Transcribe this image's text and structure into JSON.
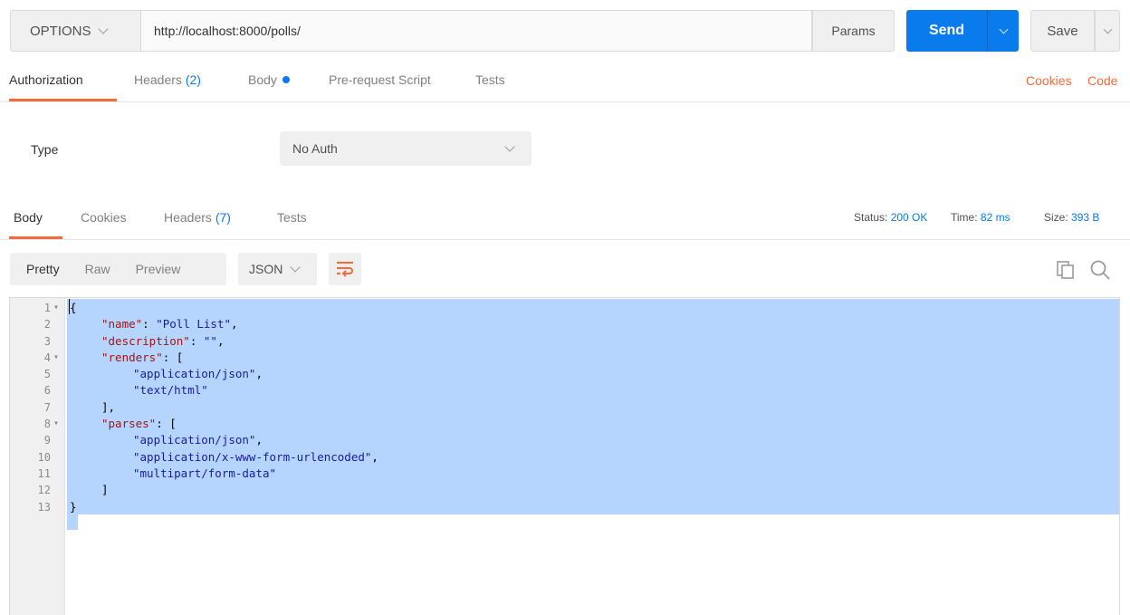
{
  "request": {
    "method": "OPTIONS",
    "url": "http://localhost:8000/polls/",
    "params_label": "Params",
    "send_label": "Send",
    "save_label": "Save"
  },
  "request_tabs": {
    "authorization": "Authorization",
    "headers": "Headers",
    "headers_count": "(2)",
    "body": "Body",
    "pre_request": "Pre-request Script",
    "tests": "Tests",
    "cookies_link": "Cookies",
    "code_link": "Code"
  },
  "auth": {
    "type_label": "Type",
    "type_value": "No Auth"
  },
  "response_tabs": {
    "body": "Body",
    "cookies": "Cookies",
    "headers": "Headers",
    "headers_count": "(7)",
    "tests": "Tests"
  },
  "response_meta": {
    "status_label": "Status:",
    "status_value": "200 OK",
    "time_label": "Time:",
    "time_value": "82 ms",
    "size_label": "Size:",
    "size_value": "393 B"
  },
  "view_modes": {
    "pretty": "Pretty",
    "raw": "Raw",
    "preview": "Preview",
    "format": "JSON"
  },
  "colors": {
    "accent_orange": "#f26b3a",
    "accent_blue": "#097bed",
    "selection": "#b5d5ff"
  },
  "icons": {
    "wrap": "wrap-lines-icon",
    "copy": "copy-icon",
    "search": "search-icon"
  },
  "response_body": [
    {
      "n": "1",
      "fold": true,
      "indent": 0,
      "parts": [
        [
          "p",
          "{"
        ]
      ]
    },
    {
      "n": "2",
      "fold": false,
      "indent": 1,
      "parts": [
        [
          "k",
          "\"name\""
        ],
        [
          "p",
          ": "
        ],
        [
          "s",
          "\"Poll List\""
        ],
        [
          "p",
          ","
        ]
      ]
    },
    {
      "n": "3",
      "fold": false,
      "indent": 1,
      "parts": [
        [
          "k",
          "\"description\""
        ],
        [
          "p",
          ": "
        ],
        [
          "s",
          "\"\""
        ],
        [
          "p",
          ","
        ]
      ]
    },
    {
      "n": "4",
      "fold": true,
      "indent": 1,
      "parts": [
        [
          "k",
          "\"renders\""
        ],
        [
          "p",
          ": ["
        ]
      ]
    },
    {
      "n": "5",
      "fold": false,
      "indent": 2,
      "parts": [
        [
          "s",
          "\"application/json\""
        ],
        [
          "p",
          ","
        ]
      ]
    },
    {
      "n": "6",
      "fold": false,
      "indent": 2,
      "parts": [
        [
          "s",
          "\"text/html\""
        ]
      ]
    },
    {
      "n": "7",
      "fold": false,
      "indent": 1,
      "parts": [
        [
          "p",
          "],"
        ]
      ]
    },
    {
      "n": "8",
      "fold": true,
      "indent": 1,
      "parts": [
        [
          "k",
          "\"parses\""
        ],
        [
          "p",
          ": ["
        ]
      ]
    },
    {
      "n": "9",
      "fold": false,
      "indent": 2,
      "parts": [
        [
          "s",
          "\"application/json\""
        ],
        [
          "p",
          ","
        ]
      ]
    },
    {
      "n": "10",
      "fold": false,
      "indent": 2,
      "parts": [
        [
          "s",
          "\"application/x-www-form-urlencoded\""
        ],
        [
          "p",
          ","
        ]
      ]
    },
    {
      "n": "11",
      "fold": false,
      "indent": 2,
      "parts": [
        [
          "s",
          "\"multipart/form-data\""
        ]
      ]
    },
    {
      "n": "12",
      "fold": false,
      "indent": 1,
      "parts": [
        [
          "p",
          "]"
        ]
      ]
    },
    {
      "n": "13",
      "fold": false,
      "indent": 0,
      "parts": [
        [
          "p",
          "}"
        ]
      ]
    }
  ]
}
